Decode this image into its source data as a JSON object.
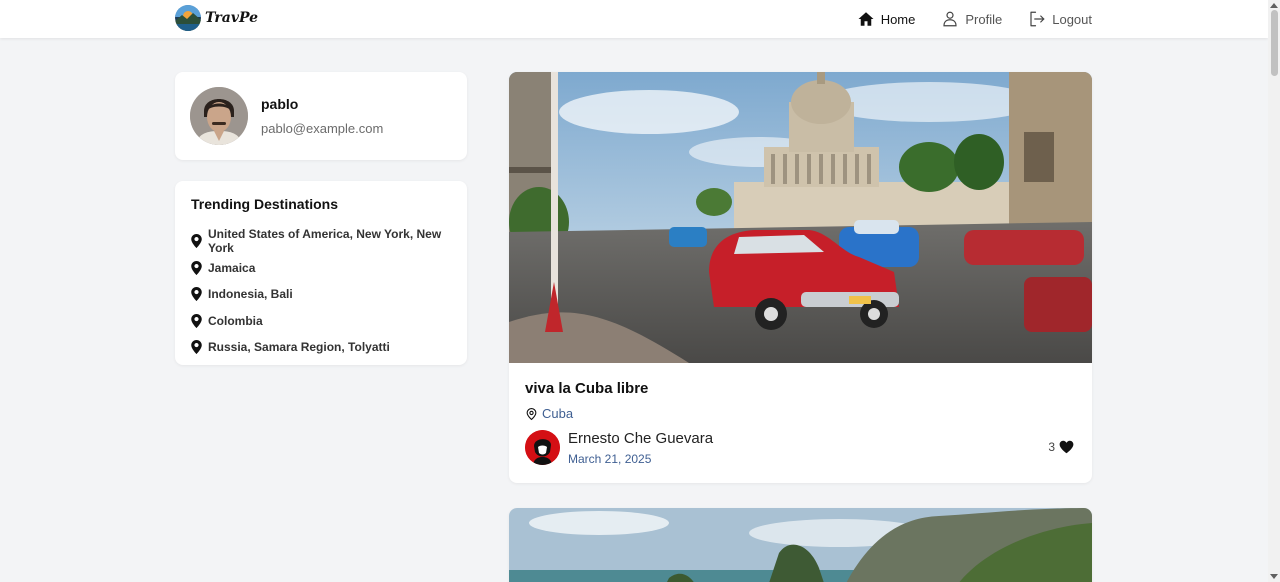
{
  "header": {
    "logo_text": "TravPe",
    "nav": [
      {
        "label": "Home",
        "icon": "home-icon",
        "active": true
      },
      {
        "label": "Profile",
        "icon": "user-icon",
        "active": false
      },
      {
        "label": "Logout",
        "icon": "logout-icon",
        "active": false
      }
    ]
  },
  "profile": {
    "name": "pablo",
    "email": "pablo@example.com"
  },
  "trending": {
    "title": "Trending Destinations",
    "items": [
      "United States of America, New York, New York",
      "Jamaica",
      "Indonesia, Bali",
      "Colombia",
      "Russia, Samara Region, Tolyatti"
    ]
  },
  "posts": [
    {
      "title": "viva la Cuba libre",
      "location": "Cuba",
      "author": "Ernesto Che Guevara",
      "date": "March 21, 2025",
      "likes": "3"
    }
  ],
  "colors": {
    "accent": "#3f5f92",
    "background": "#f3f4f6",
    "author_avatar": "#d40f14"
  }
}
